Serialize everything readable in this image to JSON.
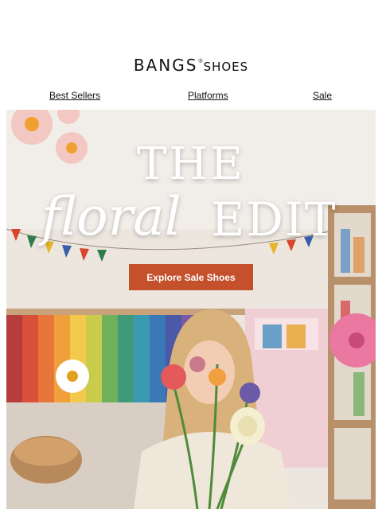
{
  "brand": {
    "logo_main": "BANGS",
    "logo_reg": "®",
    "logo_sub": "SHOES"
  },
  "nav": {
    "items": [
      {
        "label": "Best Sellers"
      },
      {
        "label": "Platforms"
      },
      {
        "label": "Sale"
      }
    ]
  },
  "hero": {
    "title_line1": "THE",
    "title_script": "floral",
    "title_line2": "EDIT",
    "cta_label": "Explore Sale Shoes",
    "cta_color": "#c4502c"
  }
}
